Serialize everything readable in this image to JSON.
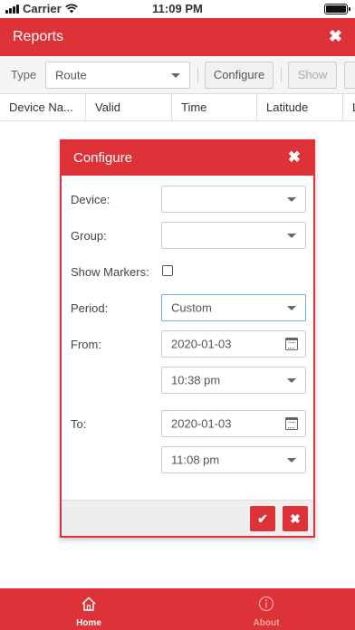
{
  "status_bar": {
    "carrier": "Carrier",
    "time": "11:09 PM",
    "battery_level": 1.0
  },
  "header": {
    "title": "Reports",
    "close_icon": "close-icon"
  },
  "toolbar": {
    "type_label": "Type",
    "type_value": "Route",
    "configure_label": "Configure",
    "show_label": "Show"
  },
  "table": {
    "columns": [
      "Device Na...",
      "Valid",
      "Time",
      "Latitude",
      "L"
    ]
  },
  "dialog": {
    "title": "Configure",
    "device_label": "Device:",
    "device_value": "",
    "group_label": "Group:",
    "group_value": "",
    "show_markers_label": "Show Markers:",
    "show_markers_checked": false,
    "period_label": "Period:",
    "period_value": "Custom",
    "from_label": "From:",
    "from_date": "2020-01-03",
    "from_time": "10:38 pm",
    "to_label": "To:",
    "to_date": "2020-01-03",
    "to_time": "11:08 pm"
  },
  "tabbar": {
    "tabs": [
      {
        "label": "Home",
        "icon": "home-icon",
        "active": true
      },
      {
        "label": "About",
        "icon": "info-icon",
        "active": false
      }
    ]
  },
  "colors": {
    "accent": "#dc3238",
    "toolbar_bg": "#f5f5f5"
  }
}
